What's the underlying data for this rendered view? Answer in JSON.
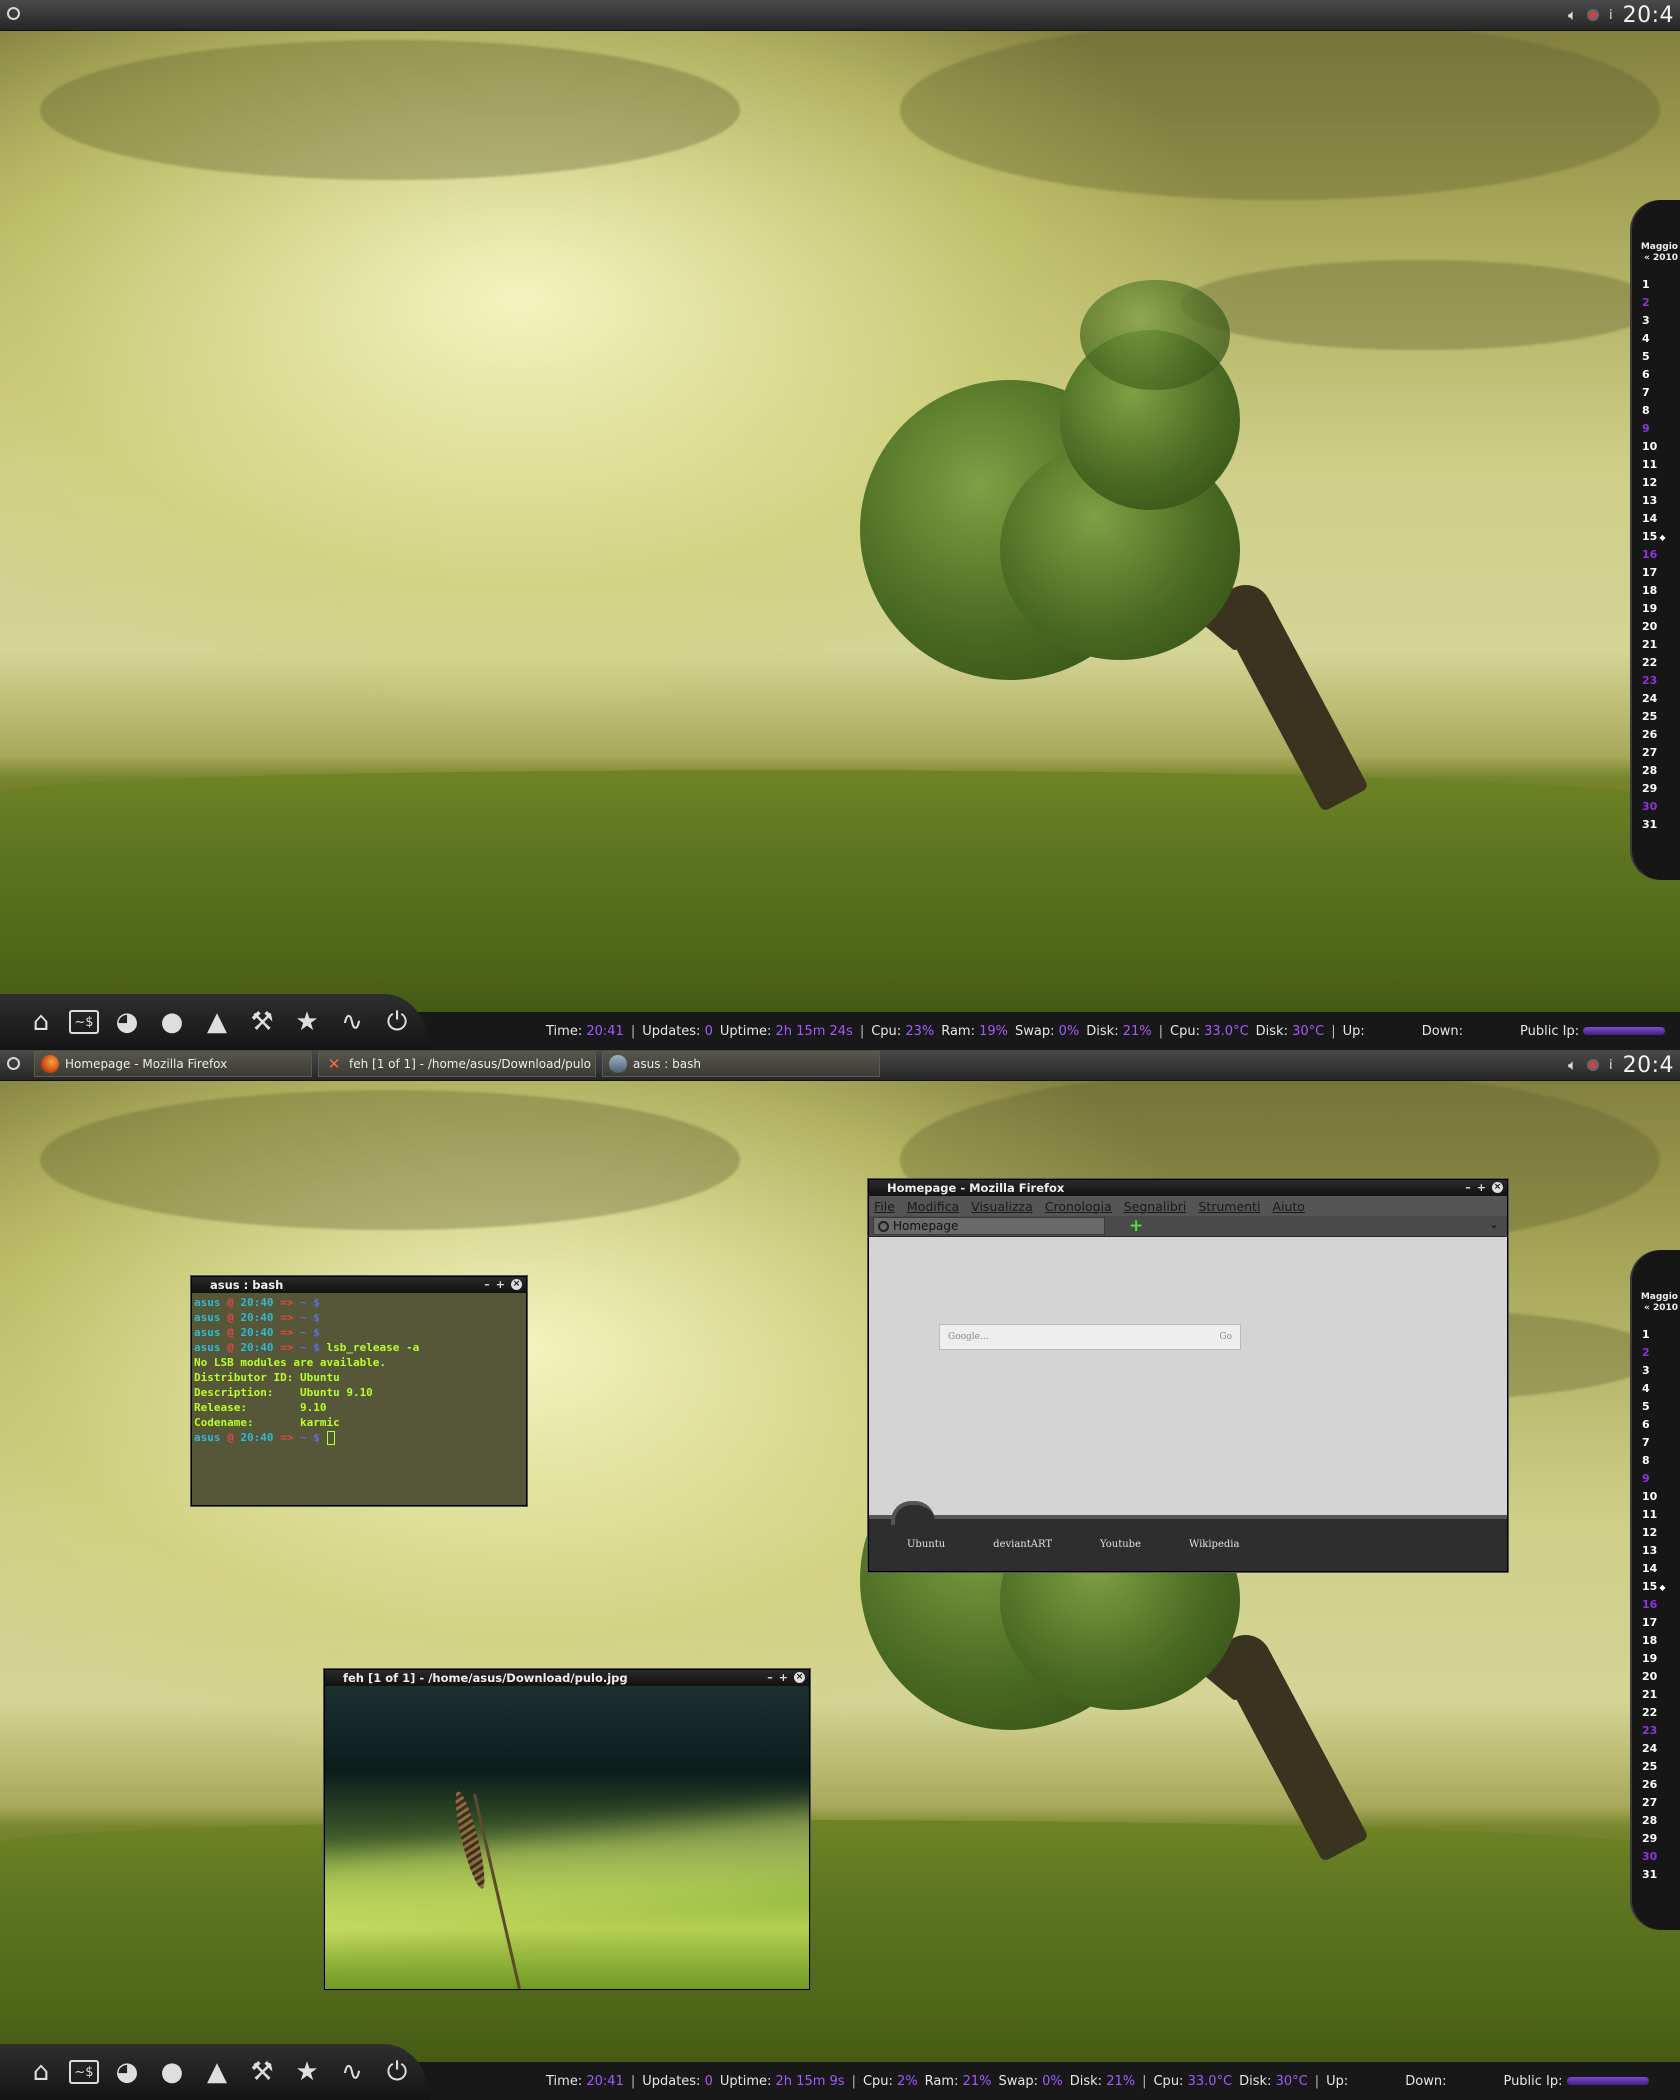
{
  "screens": [
    {
      "id": "top",
      "topbar": {
        "clock": "20:4"
      },
      "statusbar": {
        "time_label": "Time:",
        "time": "20:41",
        "updates_label": "Updates:",
        "updates": "0",
        "uptime_label": "Uptime:",
        "uptime": "2h 15m 24s",
        "cpu_label": "Cpu:",
        "cpu": "23%",
        "ram_label": "Ram:",
        "ram": "19%",
        "swap_label": "Swap:",
        "swap": "0%",
        "disk_label": "Disk:",
        "disk": "21%",
        "cputemp_label": "Cpu:",
        "cputemp": "33.0°C",
        "disktemp_label": "Disk:",
        "disktemp": "30°C",
        "up_label": "Up:",
        "down_label": "Down:",
        "ip_label": "Public Ip:"
      }
    },
    {
      "id": "bottom",
      "topbar": {
        "clock": "20:4"
      },
      "statusbar": {
        "time_label": "Time:",
        "time": "20:41",
        "updates_label": "Updates:",
        "updates": "0",
        "uptime_label": "Uptime:",
        "uptime": "2h 15m 9s",
        "cpu_label": "Cpu:",
        "cpu": "2%",
        "ram_label": "Ram:",
        "ram": "21%",
        "swap_label": "Swap:",
        "swap": "0%",
        "disk_label": "Disk:",
        "disk": "21%",
        "cputemp_label": "Cpu:",
        "cputemp": "33.0°C",
        "disktemp_label": "Disk:",
        "disktemp": "30°C",
        "up_label": "Up:",
        "down_label": "Down:",
        "ip_label": "Public Ip:"
      }
    }
  ],
  "taskbar": {
    "tasks": [
      {
        "label": "Homepage - Mozilla Firefox"
      },
      {
        "label": "feh [1 of 1] - /home/asus/Download/pulo"
      },
      {
        "label": "asus : bash"
      }
    ]
  },
  "calendar": {
    "month": "Maggio",
    "year_nav": "« 2010",
    "days": [
      "1",
      "2",
      "3",
      "4",
      "5",
      "6",
      "7",
      "8",
      "9",
      "10",
      "11",
      "12",
      "13",
      "14",
      "15",
      "16",
      "17",
      "18",
      "19",
      "20",
      "21",
      "22",
      "23",
      "24",
      "25",
      "26",
      "27",
      "28",
      "29",
      "30",
      "31"
    ],
    "weekend_days": [
      "2",
      "9",
      "16",
      "23",
      "30"
    ],
    "today": "15"
  },
  "launcher": {
    "icons": [
      "home-icon",
      "terminal-icon",
      "firefox-icon",
      "chat-icon",
      "vlc-icon",
      "wrench-icon",
      "star-icon",
      "pulse-icon",
      "power-icon"
    ],
    "terminal_glyph": "~$"
  },
  "terminal": {
    "title": "asus : bash",
    "prompt": {
      "user": "asus",
      "at": "@",
      "time": "20:40",
      "arrow": "=>",
      "dir": "~ $"
    },
    "command": "lsb_release -a",
    "output": [
      "No LSB modules are available.",
      "Distributor ID: Ubuntu",
      "Description:    Ubuntu 9.10",
      "Release:        9.10",
      "Codename:       karmic"
    ]
  },
  "firefox": {
    "title": "Homepage - Mozilla Firefox",
    "menu": [
      "File",
      "Modifica",
      "Visualizza",
      "Cronologia",
      "Segnalibri",
      "Strumenti",
      "Aiuto"
    ],
    "tab_label": "Homepage",
    "search_placeholder": "Google...",
    "search_go": "Go",
    "links": [
      "Ubuntu",
      "deviantART",
      "Youtube",
      "Wikipedia"
    ]
  },
  "feh": {
    "title": "feh [1 of 1] - /home/asus/Download/pulo.jpg"
  },
  "window_controls": {
    "minimize": "–",
    "maximize": "+",
    "close": "×"
  }
}
